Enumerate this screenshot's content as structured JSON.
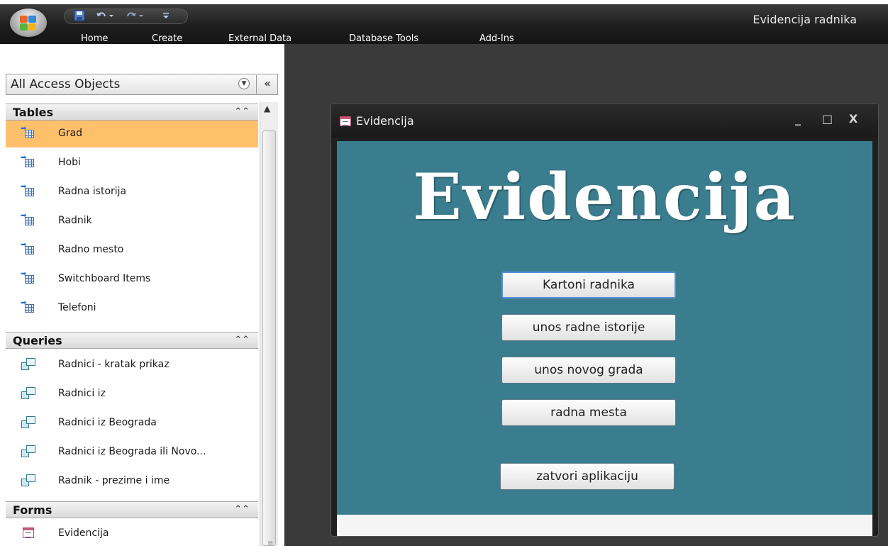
{
  "app": {
    "title": "Evidencija radnika",
    "ribbon_tabs": [
      "Home",
      "Create",
      "External Data",
      "Database Tools",
      "Add-Ins"
    ]
  },
  "nav": {
    "header": "All Access Objects",
    "groups": [
      {
        "label": "Tables",
        "items": [
          "Grad",
          "Hobi",
          "Radna istorija",
          "Radnik",
          "Radno mesto",
          "Switchboard Items",
          "Telefoni"
        ]
      },
      {
        "label": "Queries",
        "items": [
          "Radnici - kratak prikaz",
          "Radnici iz",
          "Radnici iz Beograda",
          "Radnici iz Beograda ili Novo...",
          "Radnik - prezime i ime"
        ]
      },
      {
        "label": "Forms",
        "items": [
          "Evidencija"
        ]
      }
    ],
    "selected_item": "Grad"
  },
  "form": {
    "window_title": "Evidencija",
    "heading": "Evidencija",
    "buttons": [
      "Kartoni radnika",
      "unos radne istorije",
      "unos novog grada",
      "radna mesta",
      "zatvori aplikaciju"
    ],
    "window_controls": [
      "_",
      "□",
      "X"
    ]
  },
  "colors": {
    "form_background": "#3a7d8e",
    "selected_row": "#ffc06c",
    "workspace": "#3a3a3a"
  }
}
